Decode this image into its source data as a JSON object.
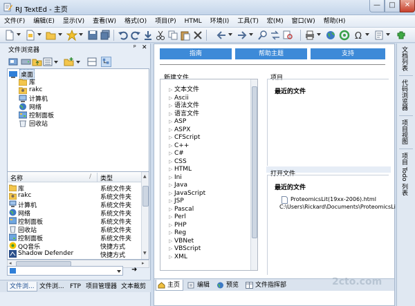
{
  "window": {
    "title": "RJ TextEd - 主页",
    "minimize": "—",
    "maximize": "□",
    "close": "✕"
  },
  "menu": [
    "文件(F)",
    "编辑(E)",
    "显示(V)",
    "查看(W)",
    "格式(O)",
    "项目(P)",
    "HTML",
    "环境(I)",
    "工具(T)",
    "宏(M)",
    "窗口(W)",
    "帮助(H)"
  ],
  "left_panel": {
    "title": "文件浏览器",
    "pin": "ᵖ",
    "close": "✕",
    "tree": [
      {
        "label": "桌面",
        "level": 0,
        "icon": "desktop-icon",
        "selected": true
      },
      {
        "label": "库",
        "level": 1,
        "icon": "library-icon"
      },
      {
        "label": "rakc",
        "level": 1,
        "icon": "user-folder-icon"
      },
      {
        "label": "计算机",
        "level": 1,
        "icon": "computer-icon"
      },
      {
        "label": "网络",
        "level": 1,
        "icon": "network-icon"
      },
      {
        "label": "控制面板",
        "level": 1,
        "icon": "control-panel-icon"
      },
      {
        "label": "回收站",
        "level": 1,
        "icon": "recycle-bin-icon"
      }
    ],
    "list_headers": {
      "name": "名称",
      "sort": "/",
      "type": "类型"
    },
    "list": [
      {
        "name": "库",
        "type": "系统文件夹",
        "icon": "library-icon"
      },
      {
        "name": "rakc",
        "type": "系统文件夹",
        "icon": "user-folder-icon"
      },
      {
        "name": "计算机",
        "type": "系统文件夹",
        "icon": "computer-icon"
      },
      {
        "name": "网络",
        "type": "系统文件夹",
        "icon": "network-icon"
      },
      {
        "name": "控制面板",
        "type": "系统文件夹",
        "icon": "control-panel-icon"
      },
      {
        "name": "回收站",
        "type": "系统文件夹",
        "icon": "recycle-bin-icon"
      },
      {
        "name": "控制面板",
        "type": "系统文件夹",
        "icon": "control-panel-icon"
      },
      {
        "name": "QQ音乐",
        "type": "快捷方式",
        "icon": "qq-music-icon"
      },
      {
        "name": "Shadow Defender",
        "type": "快捷方式",
        "icon": "shadow-defender-icon"
      }
    ],
    "tabs": [
      "文件浏...",
      "文件浏...",
      "FTP",
      "项目管理器",
      "文本裁剪"
    ],
    "go_arrow": "➜"
  },
  "main": {
    "buttons": [
      "指南",
      "帮助主题",
      "支持"
    ],
    "new_file_title": "新建文件",
    "new_files": [
      "文本文件",
      "Ascii",
      "语法文件",
      "语言文件",
      "ASP",
      "ASPX",
      "CFScript",
      "C++",
      "C#",
      "CSS",
      "HTML",
      "Ini",
      "Java",
      "JavaScript",
      "JSP",
      "Pascal",
      "Perl",
      "PHP",
      "Reg",
      "VBNet",
      "VBScript",
      "XML"
    ],
    "project_title": "项目",
    "recent_files_label": "最近的文件",
    "open_title": "打开文件",
    "open_recent_label": "最近的文件",
    "open_file_name": "ProteomicsLit(19xx-2006).html",
    "open_file_path": "C:\\Users\\Rickard\\Documents\\ProteomicsLi",
    "tabs": [
      {
        "label": "主页",
        "icon": "home-icon"
      },
      {
        "label": "编辑",
        "icon": "edit-icon"
      },
      {
        "label": "预览",
        "icon": "preview-icon"
      },
      {
        "label": "文件指挥部",
        "icon": "file-commander-icon"
      }
    ]
  },
  "right_bar": [
    "文档列表",
    "代码浏览器",
    "项目视图",
    "项目 Todo 列表"
  ],
  "watermark": "2cto.com",
  "colors": {
    "accent": "#3d8ad8",
    "panel": "#e6edf6",
    "frame": "#cfdcec"
  }
}
